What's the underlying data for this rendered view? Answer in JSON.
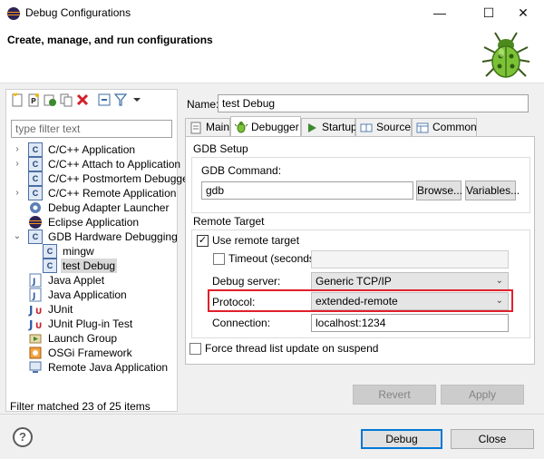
{
  "window": {
    "title": "Debug Configurations",
    "minimize": "—",
    "maximize": "☐",
    "close": "✕"
  },
  "header": {
    "title": "Create, manage, and run configurations"
  },
  "left": {
    "filter_placeholder": "type filter text",
    "status": "Filter matched 23 of 25 items",
    "items": [
      {
        "label": "C/C++ Application",
        "icon": "c-config-icon"
      },
      {
        "label": "C/C++ Attach to Application",
        "icon": "c-config-icon"
      },
      {
        "label": "C/C++ Postmortem Debugger",
        "icon": "c-config-icon"
      },
      {
        "label": "C/C++ Remote Application",
        "icon": "c-config-icon"
      },
      {
        "label": "Debug Adapter Launcher",
        "icon": "adapter-icon"
      },
      {
        "label": "Eclipse Application",
        "icon": "eclipse-icon"
      },
      {
        "label": "GDB Hardware Debugging",
        "icon": "c-config-icon"
      },
      {
        "label": "mingw",
        "icon": "c-config-icon"
      },
      {
        "label": "test Debug",
        "icon": "c-config-icon"
      },
      {
        "label": "Java Applet",
        "icon": "java-icon"
      },
      {
        "label": "Java Application",
        "icon": "java-icon"
      },
      {
        "label": "JUnit",
        "icon": "junit-icon"
      },
      {
        "label": "JUnit Plug-in Test",
        "icon": "junit-icon"
      },
      {
        "label": "Launch Group",
        "icon": "launch-group-icon"
      },
      {
        "label": "OSGi Framework",
        "icon": "osgi-icon"
      },
      {
        "label": "Remote Java Application",
        "icon": "remote-java-icon"
      }
    ]
  },
  "config": {
    "name_label": "Name:",
    "name_value": "test Debug",
    "tabs": [
      {
        "label": "Main",
        "icon": "main-tab-icon"
      },
      {
        "label": "Debugger",
        "icon": "debugger-tab-icon"
      },
      {
        "label": "Startup",
        "icon": "startup-tab-icon"
      },
      {
        "label": "Source",
        "icon": "source-tab-icon"
      },
      {
        "label": "Common",
        "icon": "common-tab-icon"
      }
    ],
    "gdb_setup_title": "GDB Setup",
    "gdb_command_label": "GDB Command:",
    "gdb_command_value": "gdb",
    "browse_label": "Browse...",
    "variables_label": "Variables...",
    "remote_target_title": "Remote Target",
    "use_remote_label": "Use remote target",
    "use_remote_checked": true,
    "timeout_label": "Timeout (seconds):",
    "timeout_checked": false,
    "timeout_value": "",
    "debug_server_label": "Debug server:",
    "debug_server_value": "Generic TCP/IP",
    "protocol_label": "Protocol:",
    "protocol_value": "extended-remote",
    "connection_label": "Connection:",
    "connection_value": "localhost:1234",
    "force_thread_label": "Force thread list update on suspend",
    "force_thread_checked": false,
    "revert_label": "Revert",
    "apply_label": "Apply",
    "highlight_color": "#e0202a"
  },
  "footer": {
    "help": "?",
    "debug_label": "Debug",
    "close_label": "Close"
  }
}
